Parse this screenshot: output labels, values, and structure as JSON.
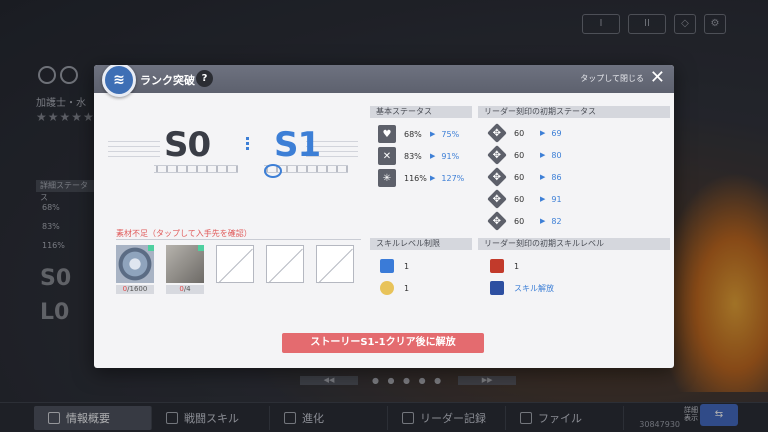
{
  "background": {
    "character_name": "加護士・水",
    "stars": "★★★★★",
    "stat_header": "詳細ステータス",
    "stats": [
      "68%",
      "83%",
      "116%"
    ],
    "rank_text": "S0",
    "level_text": "L0",
    "top_buttons": [
      "I",
      "II"
    ],
    "pager_prev": "◀◀",
    "pager_next": "▶▶",
    "pager_dots": "● ● ● ● ●",
    "player_id": "30847930",
    "bottom_label": "詳細\n表示"
  },
  "tabs": [
    {
      "label": "情報概要",
      "active": true
    },
    {
      "label": "戦闘スキル",
      "active": false
    },
    {
      "label": "進化",
      "active": false
    },
    {
      "label": "リーダー記録",
      "active": false
    },
    {
      "label": "ファイル",
      "active": false
    }
  ],
  "dialog": {
    "title": "ランク突破",
    "help": "?",
    "close_hint": "タップして閉じる",
    "close": "✕",
    "emblem": "≋",
    "rank_current": "S0",
    "rank_next": "S1",
    "materials_label": "素材不足（タップして入手先を確認）",
    "materials": [
      {
        "have": "0",
        "need": "/1600"
      },
      {
        "have": "0",
        "need": "/4"
      }
    ],
    "basic_status_header": "基本ステータス",
    "basic_status": [
      {
        "current": "68%",
        "next": "75%"
      },
      {
        "current": "83%",
        "next": "91%"
      },
      {
        "current": "116%",
        "next": "127%"
      }
    ],
    "leader_status_header": "リーダー刻印の初期ステータス",
    "leader_status": [
      {
        "current": "60",
        "next": "69"
      },
      {
        "current": "60",
        "next": "80"
      },
      {
        "current": "60",
        "next": "86"
      },
      {
        "current": "60",
        "next": "91"
      },
      {
        "current": "60",
        "next": "82"
      }
    ],
    "skill_limit_header": "スキルレベル制限",
    "skill_limit": [
      "1",
      "1"
    ],
    "leader_skill_header": "リーダー刻印の初期スキルレベル",
    "leader_skill": [
      "1",
      "スキル解放"
    ],
    "unlock_button": "ストーリーS1-1クリア後に解放"
  }
}
